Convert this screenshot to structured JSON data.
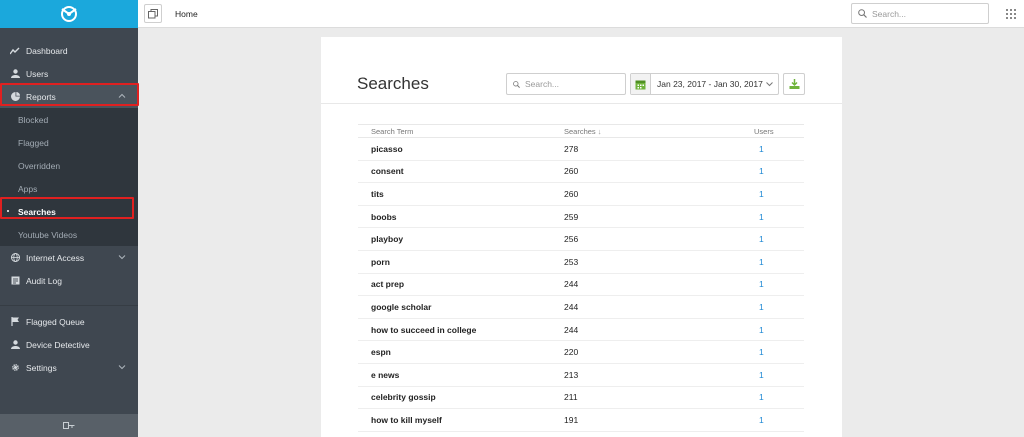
{
  "sidebar": {
    "items": [
      {
        "label": "Dashboard",
        "icon": "line-chart-icon"
      },
      {
        "label": "Users",
        "icon": "user-icon"
      },
      {
        "label": "Reports",
        "icon": "pie-chart-icon"
      },
      {
        "label": "Internet Access",
        "icon": "globe-icon"
      },
      {
        "label": "Audit Log",
        "icon": "log-icon"
      },
      {
        "label": "Flagged Queue",
        "icon": "flag-icon"
      },
      {
        "label": "Device Detective",
        "icon": "user-icon"
      },
      {
        "label": "Settings",
        "icon": "gear-icon"
      }
    ],
    "reports_sub": [
      "Blocked",
      "Flagged",
      "Overridden",
      "Apps",
      "Searches",
      "Youtube Videos"
    ],
    "active_sub": "Searches"
  },
  "topbar": {
    "breadcrumb": "Home",
    "search_placeholder": "Search..."
  },
  "card": {
    "title": "Searches",
    "search_placeholder": "Search...",
    "date_range": "Jan 23, 2017 - Jan 30, 2017"
  },
  "table": {
    "columns": [
      "Search Term",
      "Searches",
      "Users"
    ],
    "sort_indicator": "↓",
    "rows": [
      {
        "term": "picasso",
        "searches": "278",
        "users": "1"
      },
      {
        "term": "consent",
        "searches": "260",
        "users": "1"
      },
      {
        "term": "tits",
        "searches": "260",
        "users": "1"
      },
      {
        "term": "boobs",
        "searches": "259",
        "users": "1"
      },
      {
        "term": "playboy",
        "searches": "256",
        "users": "1"
      },
      {
        "term": "porn",
        "searches": "253",
        "users": "1"
      },
      {
        "term": "act prep",
        "searches": "244",
        "users": "1"
      },
      {
        "term": "google scholar",
        "searches": "244",
        "users": "1"
      },
      {
        "term": "how to succeed in college",
        "searches": "244",
        "users": "1"
      },
      {
        "term": "espn",
        "searches": "220",
        "users": "1"
      },
      {
        "term": "e news",
        "searches": "213",
        "users": "1"
      },
      {
        "term": "celebrity gossip",
        "searches": "211",
        "users": "1"
      },
      {
        "term": "how to kill myself",
        "searches": "191",
        "users": "1"
      }
    ]
  },
  "colors": {
    "brand": "#1ba8dc",
    "sidebar": "#3f4750",
    "highlight": "#e02020",
    "link": "#1e88d4",
    "calendar": "#6fb33b"
  }
}
